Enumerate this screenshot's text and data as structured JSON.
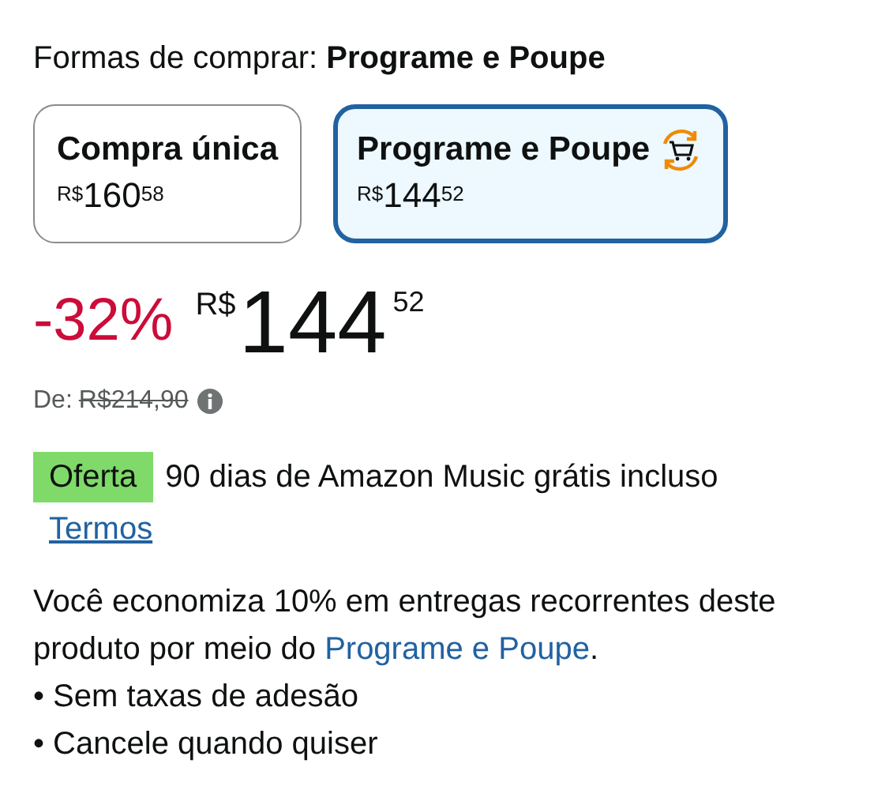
{
  "heading": "Formas de comprar: **Programe e Poupe**",
  "options": [
    {
      "label": "Compra única",
      "currency": "R$",
      "whole": "160",
      "cents": "58",
      "selected": false,
      "kind": "plain"
    },
    {
      "label": "Programe e Poupe",
      "currency": "R$",
      "whole": "144",
      "cents": "52",
      "selected": true,
      "kind": "subscribe"
    }
  ],
  "price": {
    "discount": "-32%",
    "currency": "R$",
    "whole": "144",
    "cents": "52"
  },
  "list_price": {
    "label": "De:",
    "value": "R$214,90"
  },
  "offer": {
    "badge": "Oferta",
    "text": "90 dias de Amazon Music grátis incluso",
    "link": "Termos"
  },
  "savings": {
    "text": "Você economiza 10% em entregas recorrentes deste produto por meio do ",
    "link": "Programe e Poupe",
    "end": "."
  },
  "bullets": [
    "• Sem taxas de adesão",
    "• Cancele quando quiser"
  ]
}
